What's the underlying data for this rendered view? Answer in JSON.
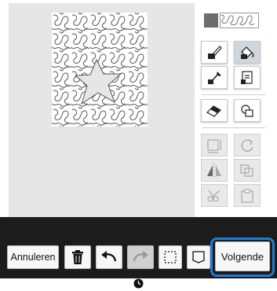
{
  "canvas": {
    "background": "#e6e6e6",
    "pattern": "stippling-with-star-cutout"
  },
  "palette": {
    "selected_fill": "#6d6d6d",
    "selected_pattern": "stippling"
  },
  "toolbar": {
    "cancel_label": "Annuleren",
    "next_label": "Volgende",
    "highlight_color": "#1f7bd6"
  },
  "status": {
    "icon": "clock-icon"
  }
}
